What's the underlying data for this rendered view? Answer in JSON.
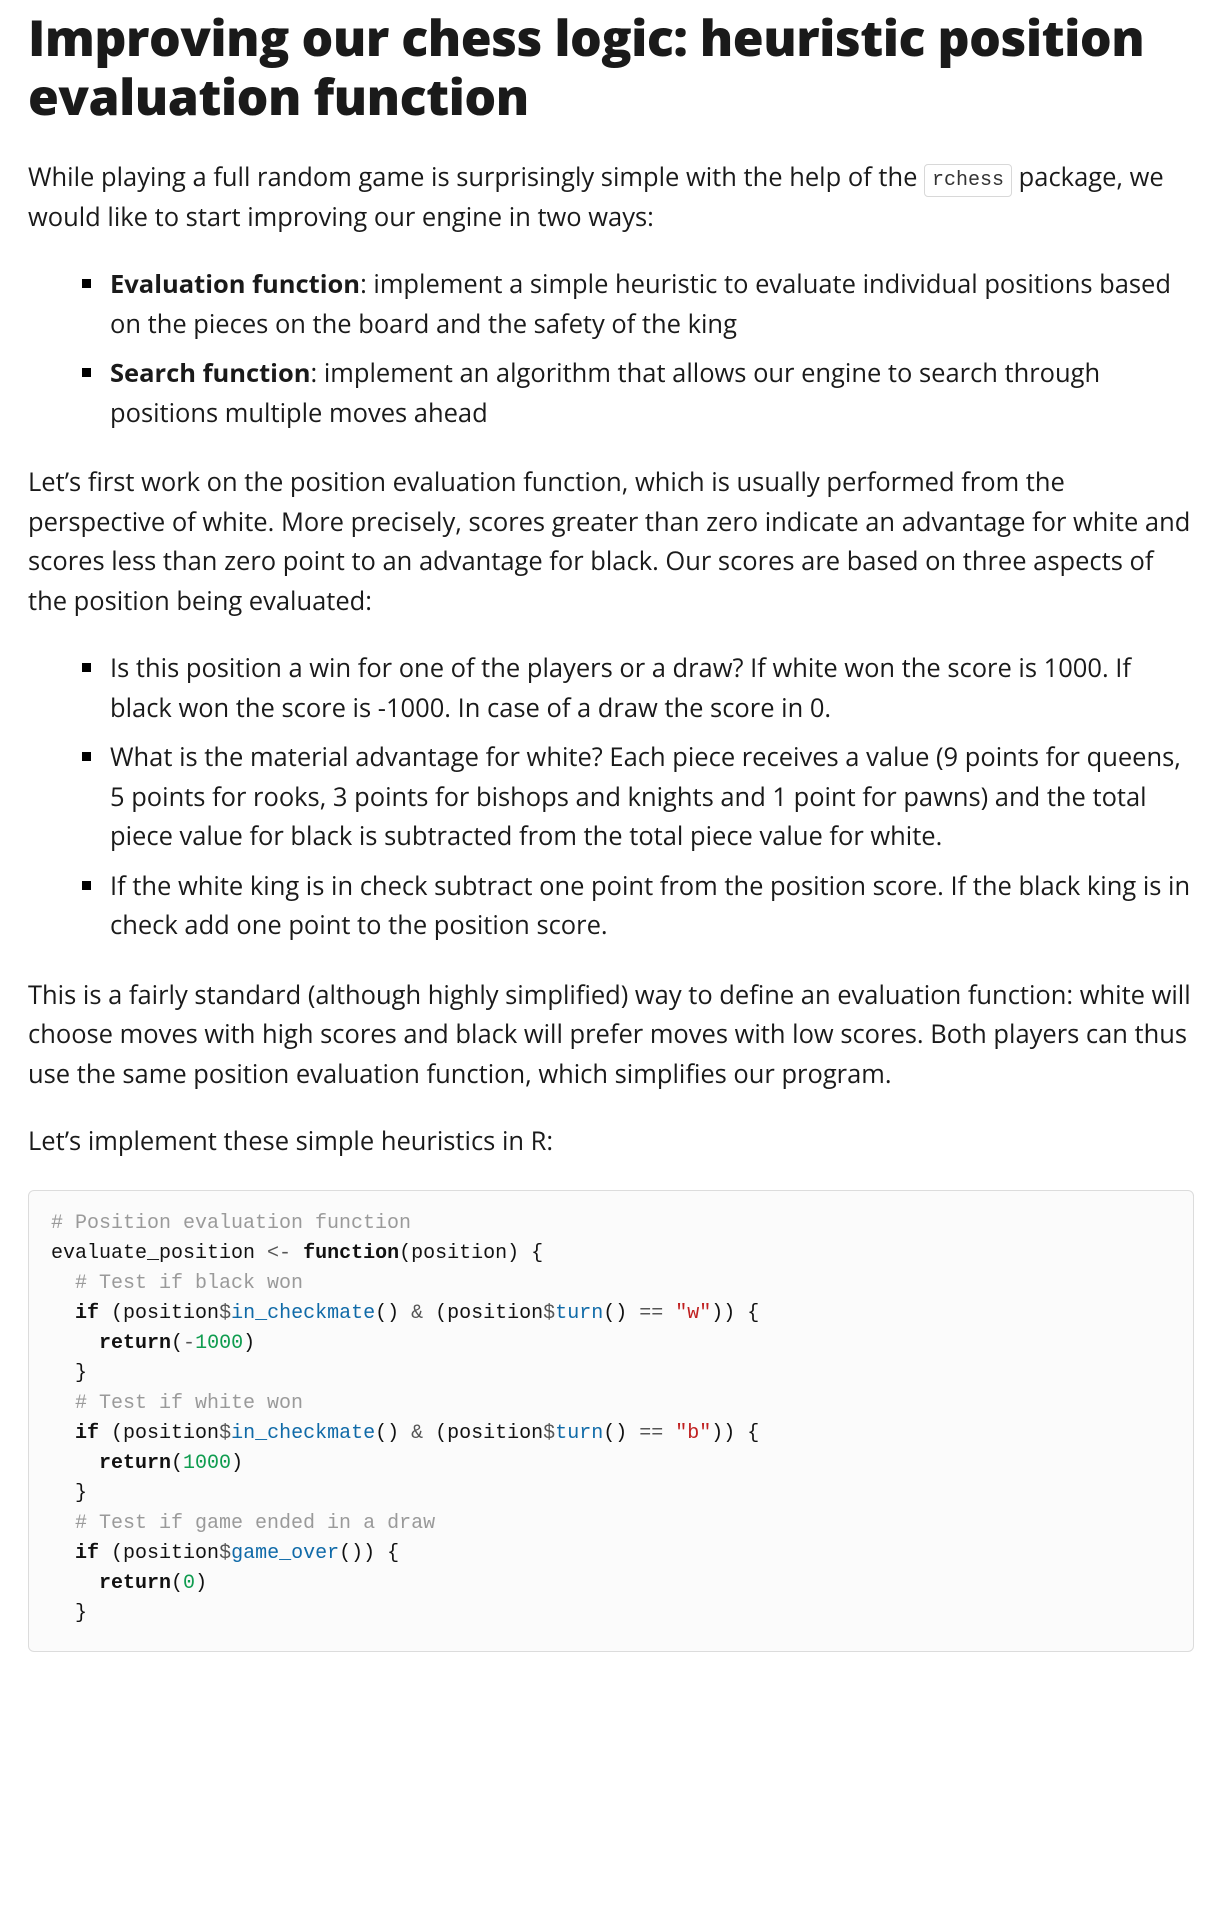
{
  "title": "Improving our chess logic: heuristic position evaluation function",
  "intro": {
    "pre": "While playing a full random game is surprisingly simple with the help of the ",
    "code": "rchess",
    "post": " package, we would like to start improving our engine in two ways:"
  },
  "list1": [
    {
      "label": "Evaluation function",
      "text": ": implement a simple heuristic to evaluate individual positions based on the pieces on the board and the safety of the king"
    },
    {
      "label": "Search function",
      "text": ": implement an algorithm that allows our engine to search through positions multiple moves ahead"
    }
  ],
  "para2": "Let’s first work on the position evaluation function, which is usually performed from the perspective of white. More precisely, scores greater than zero indicate an advantage for white and scores less than zero point to an advantage for black. Our scores are based on three aspects of the position being evaluated:",
  "list2": [
    {
      "text": "Is this position a win for one of the players or a draw? If white won the score is 1000. If black won the score is -1000. In case of a draw the score in 0."
    },
    {
      "text": "What is the material advantage for white? Each piece receives a value (9 points for queens, 5 points for rooks, 3 points for bishops and knights and 1 point for pawns) and the total piece value for black is subtracted from the total piece value for white."
    },
    {
      "text": "If the white king is in check subtract one point from the position score. If the black king is in check add one point to the position score."
    }
  ],
  "para3": "This is a fairly standard (although highly simplified) way to define an evaluation function: white will choose moves with high scores and black will prefer moves with low scores. Both players can thus use the same position evaluation function, which simplifies our program.",
  "para4": "Let’s implement these simple heuristics in R:",
  "code": {
    "lines": [
      [
        {
          "c": "comment",
          "t": "# Position evaluation function"
        }
      ],
      [
        {
          "c": "plain",
          "t": "evaluate_position "
        },
        {
          "c": "op",
          "t": "<-"
        },
        {
          "c": "plain",
          "t": " "
        },
        {
          "c": "kw",
          "t": "function"
        },
        {
          "c": "plain",
          "t": "(position) {"
        }
      ],
      [
        {
          "c": "plain",
          "t": "  "
        },
        {
          "c": "comment",
          "t": "# Test if black won"
        }
      ],
      [
        {
          "c": "plain",
          "t": "  "
        },
        {
          "c": "kw",
          "t": "if"
        },
        {
          "c": "plain",
          "t": " (position"
        },
        {
          "c": "op",
          "t": "$"
        },
        {
          "c": "fn",
          "t": "in_checkmate"
        },
        {
          "c": "plain",
          "t": "() "
        },
        {
          "c": "op",
          "t": "&"
        },
        {
          "c": "plain",
          "t": " (position"
        },
        {
          "c": "op",
          "t": "$"
        },
        {
          "c": "fn",
          "t": "turn"
        },
        {
          "c": "plain",
          "t": "() "
        },
        {
          "c": "op",
          "t": "=="
        },
        {
          "c": "plain",
          "t": " "
        },
        {
          "c": "str",
          "t": "\"w\""
        },
        {
          "c": "plain",
          "t": ")) {"
        }
      ],
      [
        {
          "c": "plain",
          "t": "    "
        },
        {
          "c": "kw",
          "t": "return"
        },
        {
          "c": "plain",
          "t": "("
        },
        {
          "c": "op",
          "t": "-"
        },
        {
          "c": "num",
          "t": "1000"
        },
        {
          "c": "plain",
          "t": ")"
        }
      ],
      [
        {
          "c": "plain",
          "t": "  }"
        }
      ],
      [
        {
          "c": "plain",
          "t": "  "
        },
        {
          "c": "comment",
          "t": "# Test if white won"
        }
      ],
      [
        {
          "c": "plain",
          "t": "  "
        },
        {
          "c": "kw",
          "t": "if"
        },
        {
          "c": "plain",
          "t": " (position"
        },
        {
          "c": "op",
          "t": "$"
        },
        {
          "c": "fn",
          "t": "in_checkmate"
        },
        {
          "c": "plain",
          "t": "() "
        },
        {
          "c": "op",
          "t": "&"
        },
        {
          "c": "plain",
          "t": " (position"
        },
        {
          "c": "op",
          "t": "$"
        },
        {
          "c": "fn",
          "t": "turn"
        },
        {
          "c": "plain",
          "t": "() "
        },
        {
          "c": "op",
          "t": "=="
        },
        {
          "c": "plain",
          "t": " "
        },
        {
          "c": "str",
          "t": "\"b\""
        },
        {
          "c": "plain",
          "t": ")) {"
        }
      ],
      [
        {
          "c": "plain",
          "t": "    "
        },
        {
          "c": "kw",
          "t": "return"
        },
        {
          "c": "plain",
          "t": "("
        },
        {
          "c": "num",
          "t": "1000"
        },
        {
          "c": "plain",
          "t": ")"
        }
      ],
      [
        {
          "c": "plain",
          "t": "  }"
        }
      ],
      [
        {
          "c": "plain",
          "t": "  "
        },
        {
          "c": "comment",
          "t": "# Test if game ended in a draw"
        }
      ],
      [
        {
          "c": "plain",
          "t": "  "
        },
        {
          "c": "kw",
          "t": "if"
        },
        {
          "c": "plain",
          "t": " (position"
        },
        {
          "c": "op",
          "t": "$"
        },
        {
          "c": "fn",
          "t": "game_over"
        },
        {
          "c": "plain",
          "t": "()) {"
        }
      ],
      [
        {
          "c": "plain",
          "t": "    "
        },
        {
          "c": "kw",
          "t": "return"
        },
        {
          "c": "plain",
          "t": "("
        },
        {
          "c": "num",
          "t": "0"
        },
        {
          "c": "plain",
          "t": ")"
        }
      ],
      [
        {
          "c": "plain",
          "t": "  }"
        }
      ]
    ]
  }
}
